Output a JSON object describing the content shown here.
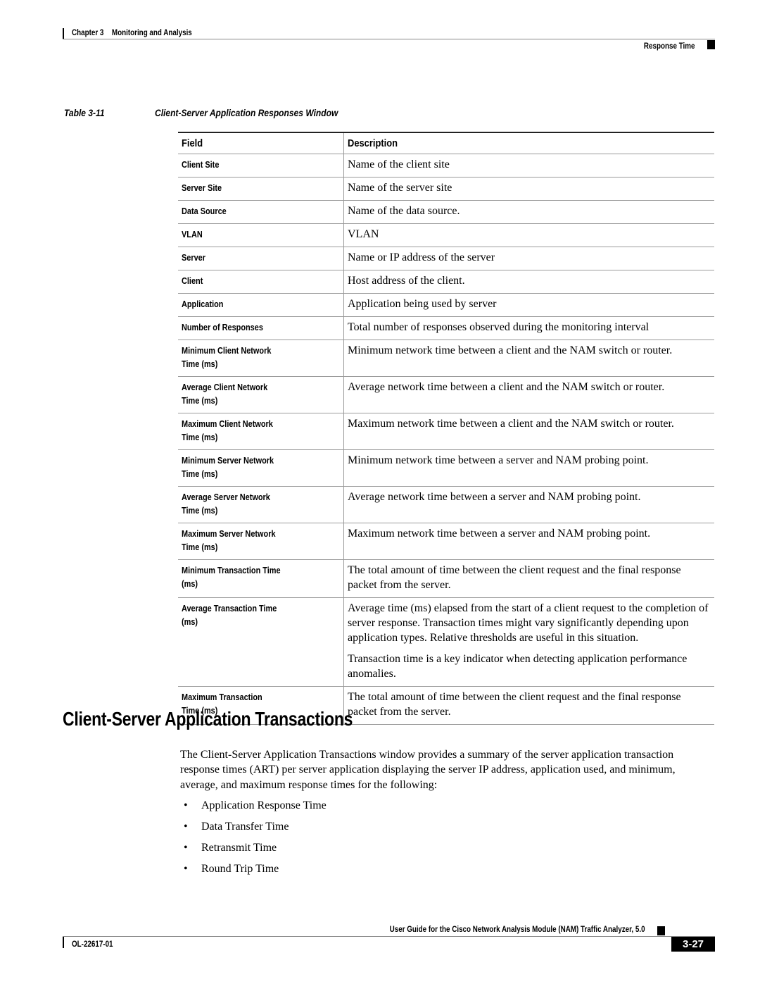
{
  "header": {
    "chapter_label": "Chapter 3",
    "chapter_title": "Monitoring and Analysis",
    "section": "Response Time"
  },
  "table": {
    "number": "Table 3-11",
    "title": "Client-Server Application Responses Window",
    "columns": [
      "Field",
      "Description"
    ],
    "rows": [
      {
        "field": "Client Site",
        "description": [
          "Name of the client site"
        ]
      },
      {
        "field": "Server Site",
        "description": [
          "Name of the server site"
        ]
      },
      {
        "field": "Data Source",
        "description": [
          "Name of the data source."
        ]
      },
      {
        "field": "VLAN",
        "description": [
          "VLAN"
        ]
      },
      {
        "field": "Server",
        "description": [
          "Name or IP address of the server"
        ]
      },
      {
        "field": "Client",
        "description": [
          "Host address of the client."
        ]
      },
      {
        "field": "Application",
        "description": [
          "Application being used by server"
        ]
      },
      {
        "field": "Number of Responses",
        "description": [
          "Total number of responses observed during the monitoring interval"
        ]
      },
      {
        "field": "Minimum Client Network\nTime (ms)",
        "description": [
          "Minimum network time between a client and the NAM switch or router."
        ]
      },
      {
        "field": "Average Client Network\nTime (ms)",
        "description": [
          "Average network time between a client and the NAM switch or router."
        ]
      },
      {
        "field": "Maximum Client Network\nTime (ms)",
        "description": [
          "Maximum network time between a client and the NAM switch or router."
        ]
      },
      {
        "field": "Minimum Server Network\nTime (ms)",
        "description": [
          "Minimum network time between a server and NAM probing point."
        ]
      },
      {
        "field": "Average Server Network\nTime (ms)",
        "description": [
          "Average network time between a server and NAM probing point."
        ]
      },
      {
        "field": "Maximum Server Network\nTime (ms)",
        "description": [
          "Maximum network time between a server and NAM probing point."
        ]
      },
      {
        "field": "Minimum Transaction Time\n(ms)",
        "description": [
          "The total amount of time between the client request and the final response packet from the server."
        ]
      },
      {
        "field": "Average Transaction Time\n(ms)",
        "description": [
          "Average time (ms) elapsed from the start of a client request to the completion of server response. Transaction times might vary significantly depending upon application types. Relative thresholds are useful in this situation.",
          "Transaction time is a key indicator when detecting application performance anomalies."
        ]
      },
      {
        "field": "Maximum Transaction\nTime (ms)",
        "description": [
          "The total amount of time between the client request and the final response packet from the server."
        ]
      }
    ]
  },
  "section": {
    "heading": "Client-Server Application Transactions",
    "paragraph": "The Client-Server Application Transactions window provides a summary of the server application transaction response times (ART) per server application displaying the server IP address, application used, and minimum, average, and maximum response times for the following:",
    "bullet_symbol": "•",
    "bullets": [
      "Application Response Time",
      "Data Transfer Time",
      "Retransmit Time",
      "Round Trip Time"
    ]
  },
  "footer": {
    "guide_title": "User Guide for the Cisco Network Analysis Module (NAM) Traffic Analyzer, 5.0",
    "doc_number": "OL-22617-01",
    "page_number": "3-27"
  }
}
